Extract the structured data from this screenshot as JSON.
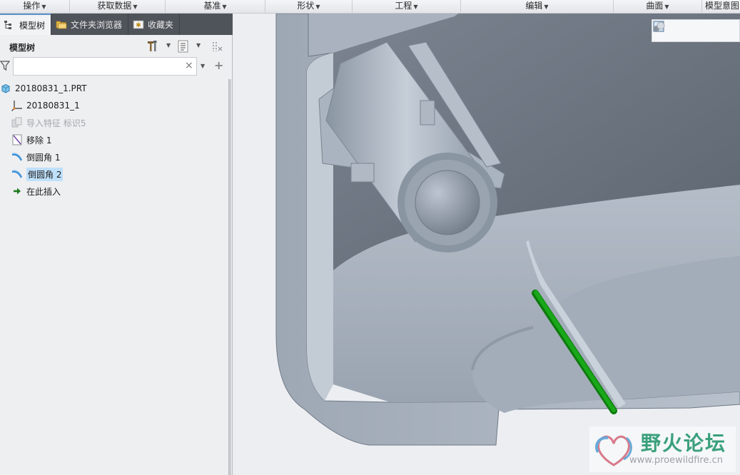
{
  "ribbon": {
    "groups": [
      {
        "label": "操作"
      },
      {
        "label": "获取数据"
      },
      {
        "label": "基准"
      },
      {
        "label": "形状"
      },
      {
        "label": "工程"
      },
      {
        "label": "编辑"
      },
      {
        "label": "曲面"
      },
      {
        "label": "模型意图"
      }
    ]
  },
  "panel": {
    "tabs": [
      {
        "label": "模型树",
        "icon": "model-tree-icon",
        "active": true
      },
      {
        "label": "文件夹浏览器",
        "icon": "folder-browser-icon",
        "active": false
      },
      {
        "label": "收藏夹",
        "icon": "favorites-icon",
        "active": false
      }
    ],
    "tree_title": "模型树",
    "search": {
      "value": "",
      "placeholder": ""
    }
  },
  "tree": {
    "items": [
      {
        "label": "20180831_1.PRT",
        "icon": "part-icon",
        "state": "normal"
      },
      {
        "label": "20180831_1",
        "icon": "coordinate-system-icon",
        "state": "normal"
      },
      {
        "label": "导入特征 标识5",
        "icon": "import-feature-icon",
        "state": "suppressed"
      },
      {
        "label": "移除 1",
        "icon": "remove-icon",
        "state": "normal"
      },
      {
        "label": "倒圆角 1",
        "icon": "round-icon",
        "state": "normal"
      },
      {
        "label": "倒圆角 2",
        "icon": "round-icon",
        "state": "selected"
      },
      {
        "label": "在此插入",
        "icon": "insert-here-arrow-icon",
        "state": "normal"
      }
    ]
  },
  "viewport": {
    "toolbar": [
      "refit-icon",
      "zoom-in-icon",
      "zoom-out-icon",
      "repaint-icon",
      "display-style-icon"
    ],
    "highlight_color": "#14a014"
  },
  "watermark": {
    "title": "野火论坛",
    "url": "www.proewildfire.cn"
  }
}
